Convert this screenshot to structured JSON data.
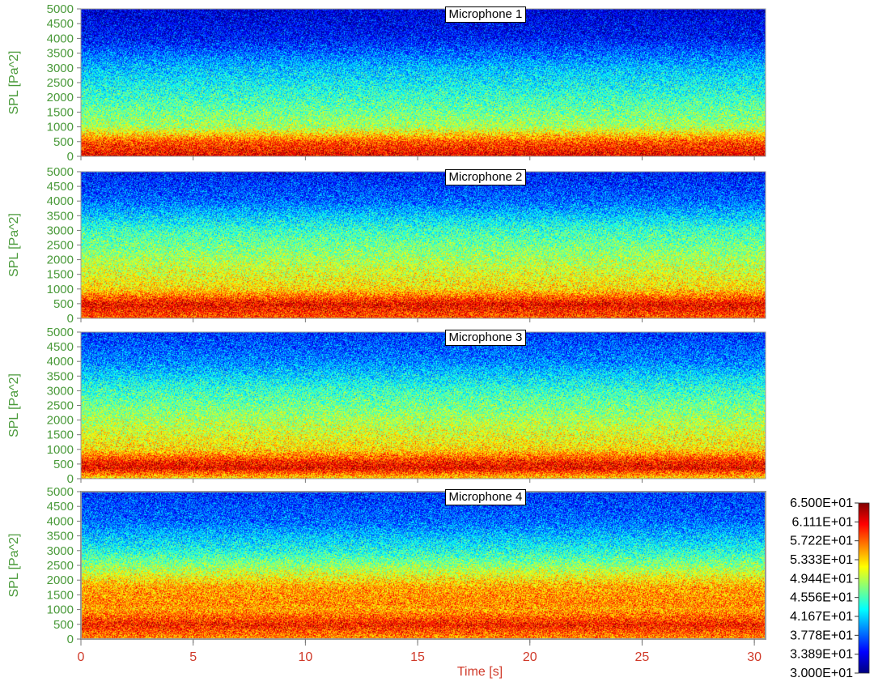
{
  "chart_data": {
    "type": "heatmap",
    "xlabel": "Time [s]",
    "xlim": [
      0,
      30.5
    ],
    "x_ticks": [
      0,
      5,
      10,
      15,
      20,
      25,
      30
    ],
    "ylim": [
      0,
      5000
    ],
    "y_ticks": [
      0,
      500,
      1000,
      1500,
      2000,
      2500,
      3000,
      3500,
      4000,
      4500,
      5000
    ],
    "colorscale": {
      "min": 30.0,
      "max": 65.0,
      "labels": [
        "6.500E+01",
        "6.111E+01",
        "5.722E+01",
        "5.333E+01",
        "4.944E+01",
        "4.556E+01",
        "4.167E+01",
        "3.778E+01",
        "3.389E+01",
        "3.000E+01"
      ],
      "colormap": "jet"
    },
    "panels": [
      {
        "title": "Microphone 1",
        "ylabel": "SPL [Pa^2]",
        "band_levels": [
          {
            "y": 50,
            "level": 61
          },
          {
            "y": 480,
            "level": 58
          },
          {
            "y": 650,
            "level": 55
          },
          {
            "y": 1000,
            "level": 49
          },
          {
            "y": 2000,
            "level": 45
          },
          {
            "y": 3000,
            "level": 41
          },
          {
            "y": 4000,
            "level": 35
          },
          {
            "y": 5000,
            "level": 33
          }
        ]
      },
      {
        "title": "Microphone 2",
        "ylabel": "SPL [Pa^2]",
        "band_levels": [
          {
            "y": 50,
            "level": 58
          },
          {
            "y": 480,
            "level": 61
          },
          {
            "y": 1000,
            "level": 53
          },
          {
            "y": 2000,
            "level": 49
          },
          {
            "y": 3000,
            "level": 45
          },
          {
            "y": 4000,
            "level": 38
          },
          {
            "y": 5000,
            "level": 35
          }
        ]
      },
      {
        "title": "Microphone 3",
        "ylabel": "SPL [Pa^2]",
        "band_levels": [
          {
            "y": 50,
            "level": 54
          },
          {
            "y": 350,
            "level": 61
          },
          {
            "y": 550,
            "level": 60
          },
          {
            "y": 1000,
            "level": 53
          },
          {
            "y": 2000,
            "level": 49
          },
          {
            "y": 3000,
            "level": 45
          },
          {
            "y": 4000,
            "level": 39
          },
          {
            "y": 5000,
            "level": 36
          }
        ]
      },
      {
        "title": "Microphone 4",
        "ylabel": "SPL [Pa^2]",
        "band_levels": [
          {
            "y": 50,
            "level": 56
          },
          {
            "y": 480,
            "level": 60
          },
          {
            "y": 1000,
            "level": 55
          },
          {
            "y": 1200,
            "level": 56
          },
          {
            "y": 1750,
            "level": 55
          },
          {
            "y": 2500,
            "level": 48
          },
          {
            "y": 3000,
            "level": 44
          },
          {
            "y": 4000,
            "level": 38
          },
          {
            "y": 5000,
            "level": 36
          }
        ]
      }
    ]
  },
  "colors": {
    "axis_text": "#4a9a3a",
    "time_text": "#d03a2a"
  }
}
